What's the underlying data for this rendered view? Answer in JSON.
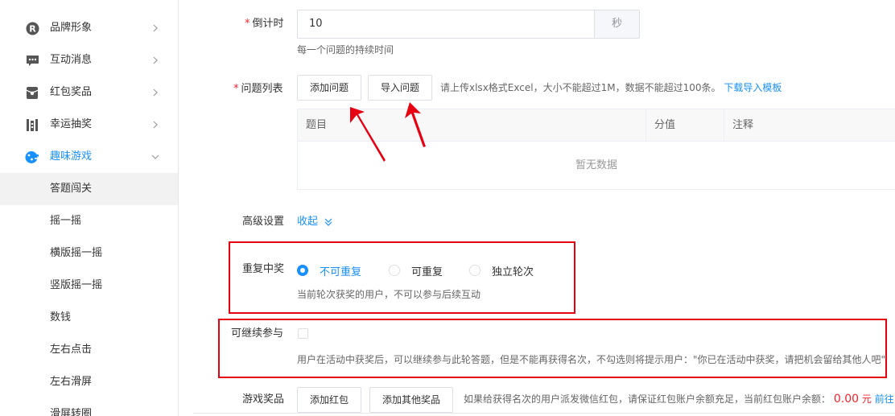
{
  "sidebar": {
    "partial_top_label": "...",
    "items": [
      {
        "label": "品牌形象",
        "icon": "r-circle-icon"
      },
      {
        "label": "互动消息",
        "icon": "message-icon"
      },
      {
        "label": "红包奖品",
        "icon": "red-packet-icon"
      },
      {
        "label": "幸运抽奖",
        "icon": "lottery-icon"
      },
      {
        "label": "趣味游戏",
        "icon": "gamepad-icon"
      }
    ],
    "sub_items": [
      "答题闯关",
      "摇一摇",
      "横版摇一摇",
      "竖版摇一摇",
      "数钱",
      "左右点击",
      "左右滑屏",
      "滑屏转圈"
    ]
  },
  "form": {
    "countdown": {
      "label": "倒计时",
      "value": "10",
      "suffix": "秒",
      "hint": "每一个问题的持续时间"
    },
    "questions": {
      "label": "问题列表",
      "add_button": "添加问题",
      "import_button": "导入问题",
      "hint": "请上传xlsx格式Excel，大小不能超过1M，数据不能超过100条。",
      "download_link": "下载导入模板",
      "columns": [
        "题目",
        "分值",
        "注释"
      ],
      "empty_text": "暂无数据"
    },
    "advanced": {
      "label": "高级设置",
      "toggle": "收起"
    },
    "repeat_win": {
      "label": "重复中奖",
      "options": [
        "不可重复",
        "可重复",
        "独立轮次"
      ],
      "selected": "不可重复",
      "hint": "当前轮次获奖的用户，不可以参与后续互动"
    },
    "continue": {
      "label": "可继续参与",
      "checked": false,
      "hint": "用户在活动中获奖后，可以继续参与此轮答题，但是不能再获得名次，不勾选则将提示用户：\"你已在活动中获奖，请把机会留给其他人吧\""
    },
    "prizes": {
      "label": "游戏奖品",
      "add_red_packet": "添加红包",
      "add_other": "添加其他奖品",
      "hint": "如果给获得名次的用户派发微信红包，请保证红包账户余额充足，当前红包账户余额：",
      "balance": "0.00",
      "currency": "元",
      "link": "前往"
    }
  },
  "colors": {
    "accent": "#1890ff",
    "annotation_red": "#e60012",
    "required": "#f5222d"
  }
}
